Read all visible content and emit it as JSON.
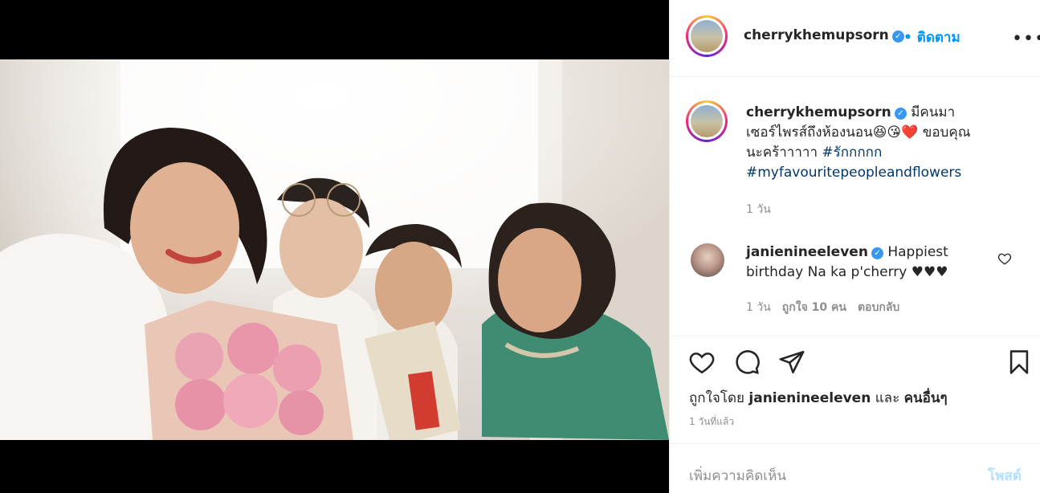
{
  "post": {
    "username": "cherrykhemupsorn",
    "follow_label": "ติดตาม",
    "more_label": "•••",
    "bullet": "•",
    "caption_line1": "มีคนมา",
    "caption_line2": "เซอร์ไพรส์ถึงห้องนอน😆😘❤️ ขอบคุณ",
    "caption_line3": "นะคร้าาาาา ",
    "caption_hashtag1": "#รักกกกก",
    "caption_hashtag2": "#myfavouritepeopleandflowers",
    "caption_time": "1 วัน"
  },
  "comment": {
    "username": "janienineeleven",
    "text_line1": "Happiest",
    "text_line2": "birthday Na ka p'cherry ♥♥♥",
    "time": "1 วัน",
    "likes": "ถูกใจ 10 คน",
    "reply": "ตอบกลับ"
  },
  "likes": {
    "prefix": "ถูกใจโดย",
    "user": "janienineeleven",
    "and": "และ",
    "others": "คนอื่นๆ"
  },
  "timestamp": "1 วันที่แล้ว",
  "add_comment": {
    "placeholder": "เพิ่มความคิดเห็น",
    "post_label": "โพสต์"
  },
  "icons": [
    "more-icon",
    "verified-icon",
    "heart-icon",
    "comment-icon",
    "share-icon",
    "bookmark-icon"
  ],
  "colors": {
    "link": "#00376b",
    "follow": "#0095f6",
    "verified": "#3897f0",
    "post_disabled": "#b2dffc"
  }
}
